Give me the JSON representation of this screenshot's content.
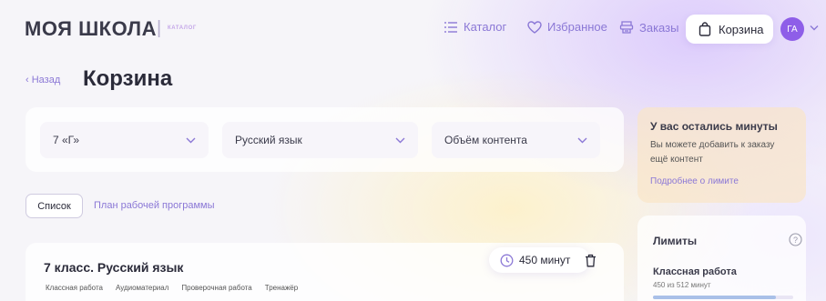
{
  "header": {
    "logo": "МОЯ ШКОЛА",
    "logo_sub": "КАТАЛОГ",
    "nav": {
      "catalog": "Каталог",
      "favorites": "Избранное",
      "orders": "Заказы",
      "cart": "Корзина"
    },
    "avatar_initials": "ГА"
  },
  "page": {
    "back_label": "Назад",
    "title": "Корзина"
  },
  "filters": {
    "class": "7 «Г»",
    "subject": "Русский язык",
    "content_volume": "Объём контента"
  },
  "tabs": {
    "list": "Список",
    "plan": "План рабочей программы"
  },
  "course_card": {
    "title": "7 класс. Русский язык",
    "tags": [
      "Классная работа",
      "Аудиоматериал",
      "Проверочная работа",
      "Тренажёр"
    ],
    "minutes": "450 минут"
  },
  "info_panel": {
    "title": "У вас остались минуты",
    "text": "Вы можете добавить к заказу ещё контент",
    "link": "Подробнее о лимите"
  },
  "limits": {
    "title": "Лимиты",
    "items": [
      {
        "name": "Классная работа",
        "value": "450 из 512 минут",
        "fraction": 0.879
      }
    ]
  },
  "colors": {
    "accent": "#8b78d6",
    "avatar": "#8e5ee8",
    "limit_bar": "#a9c0e8"
  }
}
